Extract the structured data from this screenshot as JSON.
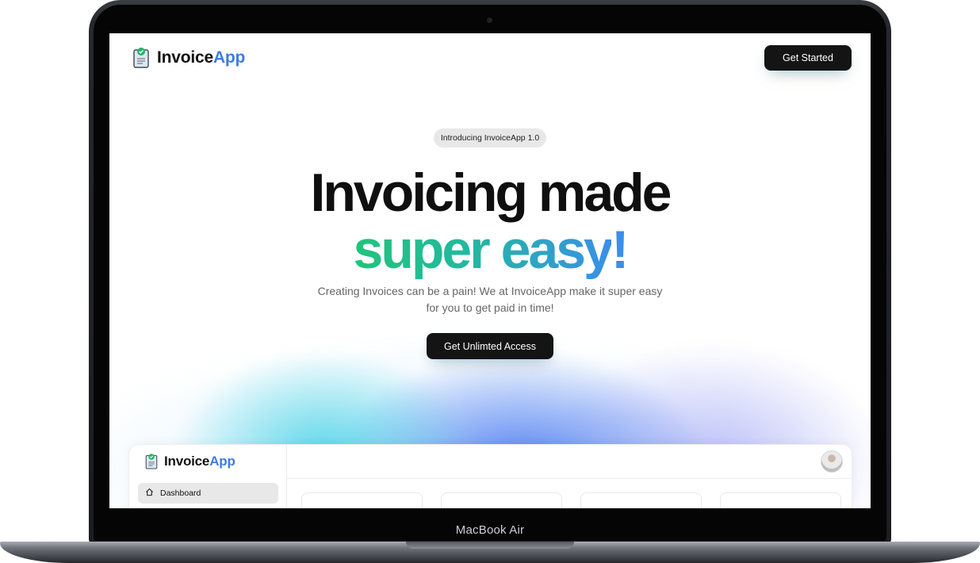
{
  "device": {
    "model_label": "MacBook Air"
  },
  "nav": {
    "brand_primary": "Invoice",
    "brand_accent": "App",
    "cta_label": "Get Started"
  },
  "hero": {
    "badge": "Introducing InvoiceApp 1.0",
    "headline_line1": "Invoicing made",
    "headline_line2": "super easy",
    "headline_exclaim": "!",
    "subtitle": "Creating Invoices can be a pain! We at InvoiceApp make it super easy for you to get paid in time!",
    "cta_label": "Get Unlimted Access"
  },
  "dashboard_preview": {
    "brand_primary": "Invoice",
    "brand_accent": "App",
    "nav_items": [
      {
        "label": "Dashboard",
        "icon": "home-icon",
        "active": true
      }
    ],
    "avatar": "user-avatar"
  },
  "colors": {
    "brand_accent": "#3e7be6",
    "button_bg": "#141414",
    "headline_gradient_start": "#22c47a",
    "headline_gradient_end": "#3b8fe8"
  }
}
